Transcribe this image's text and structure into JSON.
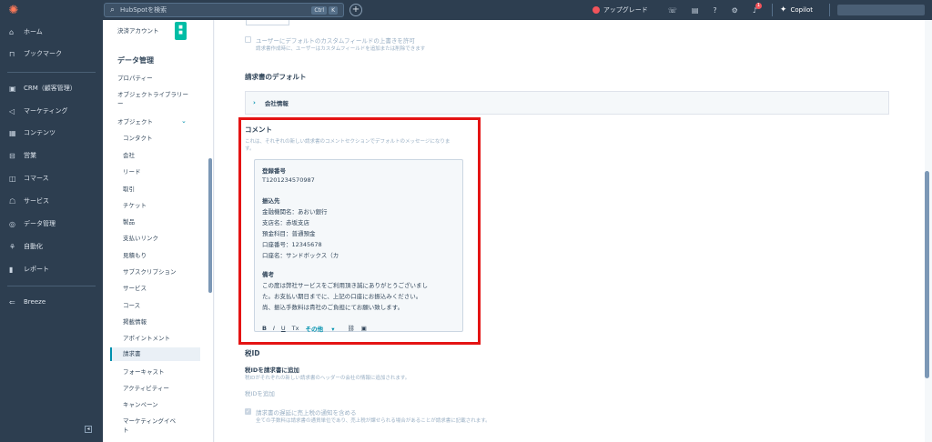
{
  "topbar": {
    "search_placeholder": "HubSpotを検索",
    "shortcut_key1": "Ctrl",
    "shortcut_key2": "K",
    "upgrade_label": "アップグレード",
    "notification_count": "1",
    "copilot_label": "Copilot"
  },
  "leftnav": {
    "items": [
      {
        "label": "ホーム",
        "icon": "home-icon"
      },
      {
        "label": "ブックマーク",
        "icon": "bookmark-icon"
      },
      {
        "label": "CRM（顧客管理）",
        "icon": "crm-icon"
      },
      {
        "label": "マーケティング",
        "icon": "marketing-icon"
      },
      {
        "label": "コンテンツ",
        "icon": "content-icon"
      },
      {
        "label": "営業",
        "icon": "sales-icon"
      },
      {
        "label": "コマース",
        "icon": "commerce-icon"
      },
      {
        "label": "サービス",
        "icon": "service-icon"
      },
      {
        "label": "データ管理",
        "icon": "data-icon"
      },
      {
        "label": "自動化",
        "icon": "automation-icon"
      },
      {
        "label": "レポート",
        "icon": "report-icon"
      },
      {
        "label": "Breeze",
        "icon": "breeze-icon"
      }
    ]
  },
  "settings_sidebar": {
    "payment_account": "決済アカウント",
    "data_mgmt_heading": "データ管理",
    "properties": "プロパティー",
    "object_library_1": "オブジェクトライブラリー",
    "object_library_2": "ー",
    "objects": "オブジェクト",
    "sub_items": [
      "コンタクト",
      "会社",
      "リード",
      "取引",
      "チケット",
      "製品",
      "支払いリンク",
      "見積もり",
      "サブスクリプション",
      "サービス",
      "コース",
      "掲載情報",
      "アポイントメント",
      "請求書",
      "フォーキャスト",
      "アクティビティー",
      "キャンペーン",
      "マーケティングイベ",
      "ト"
    ]
  },
  "main": {
    "custom_field_checkbox_label": "ユーザーにデフォルトのカスタムフィールドの上書きを許可",
    "custom_field_checkbox_desc": "請求書作成時に、ユーザーはカスタムフィールドを追加または削除できます",
    "invoice_defaults_title": "請求書のデフォルト",
    "company_info_label": "会社情報",
    "comment_title": "コメント",
    "comment_desc_1": "これは、それぞれの新しい請求書のコメントセクションでデフォルトのメッセージになりま",
    "comment_desc_2": "す。",
    "comment_lines": [
      {
        "text": "登録番号",
        "bold": true
      },
      {
        "text": "T1201234570987",
        "bold": false
      },
      {
        "text": "振込先",
        "bold": true
      },
      {
        "text": "金融機関名：あおい銀行",
        "bold": false
      },
      {
        "text": "支店名：赤坂支店",
        "bold": false
      },
      {
        "text": "預金科目：普通預金",
        "bold": false
      },
      {
        "text": "口座番号：12345678",
        "bold": false
      },
      {
        "text": "口座名：サンドボックス（カ",
        "bold": false
      },
      {
        "text": "備考",
        "bold": true
      },
      {
        "text": "この度は弊社サービスをご利用頂き誠にありがとうございまし",
        "bold": false
      },
      {
        "text": "た。お支払い期日までに、上記の口座にお振込みください。",
        "bold": false
      },
      {
        "text": "尚、振込手数料は貴社のご負担にてお願い致します。",
        "bold": false
      }
    ],
    "toolbar": {
      "bold": "B",
      "italic": "I",
      "underline": "U",
      "clear": "Tx",
      "more": "その他",
      "more_caret": "▾",
      "link": "⛓",
      "image": "▣"
    },
    "tax_id_title": "税ID",
    "tax_id_add_heading": "税IDを請求書に追加",
    "tax_id_add_desc": "税IDがそれぞれの新しい請求書のヘッダーの会社の情報に追加されます。",
    "tax_id_add_link": "税IDを追加",
    "overdue_checkbox_label": "請求書の遅延に売上税の通知を含める",
    "overdue_checkbox_desc": "全ての手数料は請求書の通貨単位であり、売上税が課せられる場合があることが請求書に記載されます。"
  }
}
